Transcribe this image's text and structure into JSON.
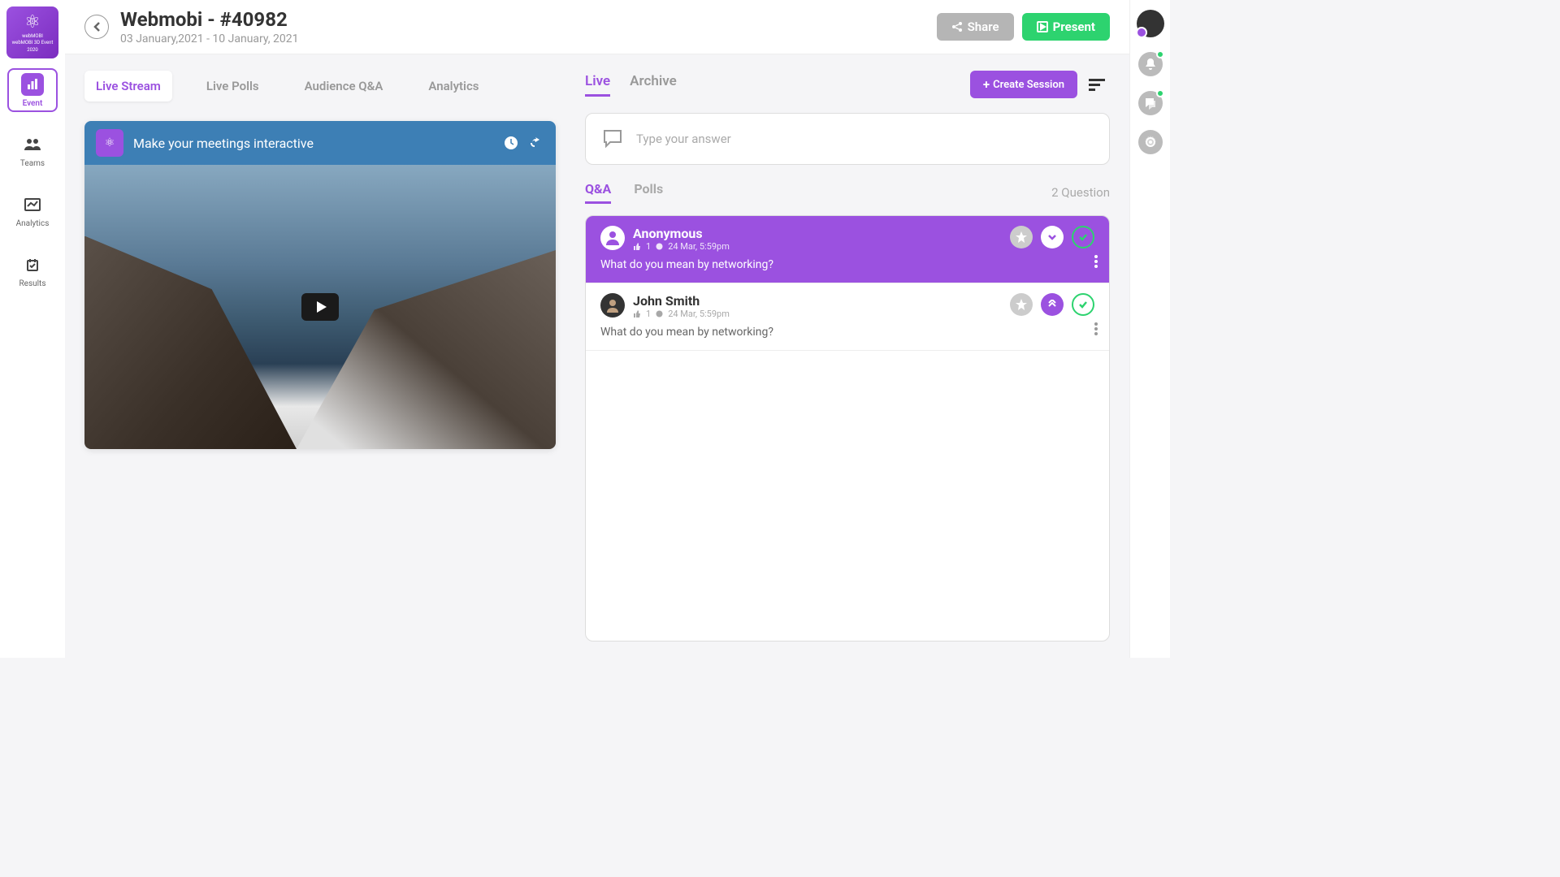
{
  "sidebar": {
    "logo_lines": [
      "webMOBI",
      "webMOBI 3D Event",
      "2020"
    ],
    "items": [
      {
        "label": "Event",
        "active": true
      },
      {
        "label": "Teams",
        "active": false
      },
      {
        "label": "Analytics",
        "active": false
      },
      {
        "label": "Results",
        "active": false
      }
    ]
  },
  "header": {
    "title": "Webmobi - #40982",
    "subtitle": "03 January,2021 - 10 January, 2021",
    "share_label": "Share",
    "present_label": "Present"
  },
  "main_tabs": [
    {
      "label": "Live Stream",
      "active": true
    },
    {
      "label": "Live Polls",
      "active": false
    },
    {
      "label": "Audience Q&A",
      "active": false
    },
    {
      "label": "Analytics",
      "active": false
    }
  ],
  "video": {
    "title": "Make your meetings interactive"
  },
  "qa": {
    "tabs": [
      {
        "label": "Live",
        "active": true
      },
      {
        "label": "Archive",
        "active": false
      }
    ],
    "create_session_label": "Create Session",
    "answer_placeholder": "Type your answer",
    "subtabs": [
      {
        "label": "Q&A",
        "active": true
      },
      {
        "label": "Polls",
        "active": false
      }
    ],
    "count_text": "2 Question",
    "questions": [
      {
        "name": "Anonymous",
        "likes": "1",
        "time": "24 Mar, 5:59pm",
        "text": "What do you mean by networking?",
        "highlighted": true,
        "chev": "down"
      },
      {
        "name": "John Smith",
        "likes": "1",
        "time": "24 Mar, 5:59pm",
        "text": "What do you mean by networking?",
        "highlighted": false,
        "chev": "up"
      }
    ]
  }
}
